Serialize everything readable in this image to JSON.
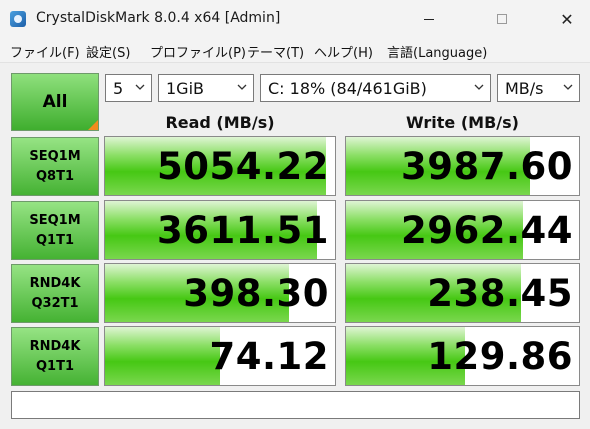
{
  "window": {
    "title": "CrystalDiskMark 8.0.4 x64 [Admin]",
    "close_glyph": "✕"
  },
  "menu": [
    "ファイル(F)",
    "設定(S)",
    "プロファイル(P)",
    "テーマ(T)",
    "ヘルプ(H)",
    "言語(Language)"
  ],
  "controls": {
    "all_label": "All",
    "count": "5",
    "size": "1GiB",
    "drive": "C: 18% (84/461GiB)",
    "unit": "MB/s"
  },
  "columns": {
    "read": "Read (MB/s)",
    "write": "Write (MB/s)"
  },
  "rows": [
    {
      "line1": "SEQ1M",
      "line2": "Q8T1",
      "read": "5054.22",
      "write": "3987.60",
      "read_fill": 0.96,
      "write_fill": 0.79
    },
    {
      "line1": "SEQ1M",
      "line2": "Q1T1",
      "read": "3611.51",
      "write": "2962.44",
      "read_fill": 0.92,
      "write_fill": 0.76
    },
    {
      "line1": "RND4K",
      "line2": "Q32T1",
      "read": "398.30",
      "write": "238.45",
      "read_fill": 0.8,
      "write_fill": 0.75
    },
    {
      "line1": "RND4K",
      "line2": "Q1T1",
      "read": "74.12",
      "write": "129.86",
      "read_fill": 0.5,
      "write_fill": 0.51
    }
  ],
  "status": ""
}
